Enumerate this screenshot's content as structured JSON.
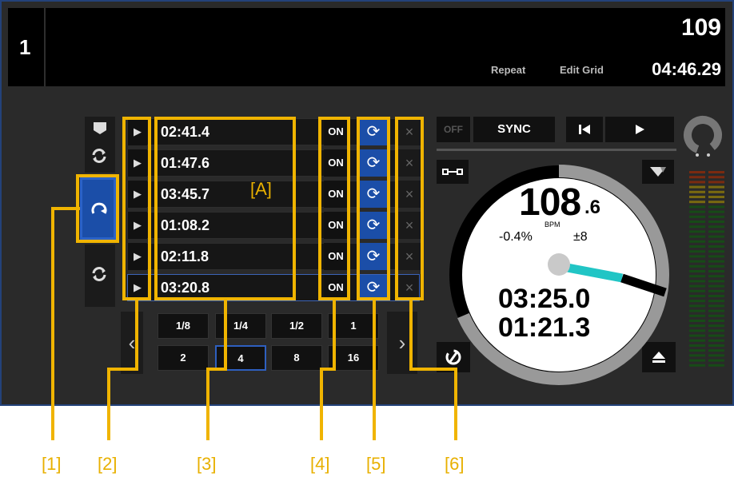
{
  "deck": {
    "number": "1",
    "bpm_top": "109",
    "repeat_label": "Repeat",
    "edit_grid_label": "Edit Grid",
    "time_top": "04:46.29"
  },
  "loops": [
    {
      "time": "02:41.4",
      "on_label": "ON"
    },
    {
      "time": "01:47.6",
      "on_label": "ON"
    },
    {
      "time": "03:45.7",
      "on_label": "ON"
    },
    {
      "time": "01:08.2",
      "on_label": "ON"
    },
    {
      "time": "02:11.8",
      "on_label": "ON"
    },
    {
      "time": "03:20.8",
      "on_label": "ON"
    }
  ],
  "beat_sizes_top": [
    "1/8",
    "1/4",
    "1/2",
    "1"
  ],
  "beat_sizes_bottom": [
    "2",
    "4",
    "8",
    "16"
  ],
  "beat_selected": "4",
  "controls": {
    "off_label": "OFF",
    "sync_label": "SYNC"
  },
  "platter": {
    "bpm_main": "108",
    "bpm_decimal": ".6",
    "bpm_unit": "BPM",
    "pitch": "-0.4%",
    "range": "±8",
    "elapsed": "03:25.0",
    "remaining": "01:21.3"
  },
  "annotations": {
    "a_label": "[A]",
    "labels": [
      "[1]",
      "[2]",
      "[3]",
      "[4]",
      "[5]",
      "[6]"
    ]
  },
  "colors": {
    "accent_blue": "#1b4ea8",
    "annotation": "#f0b400",
    "needle": "#21c5c5"
  },
  "icons": {
    "play": "play-icon",
    "loop": "loop-icon",
    "delete": "close-icon",
    "prev": "skip-back-icon",
    "eject": "eject-icon"
  }
}
